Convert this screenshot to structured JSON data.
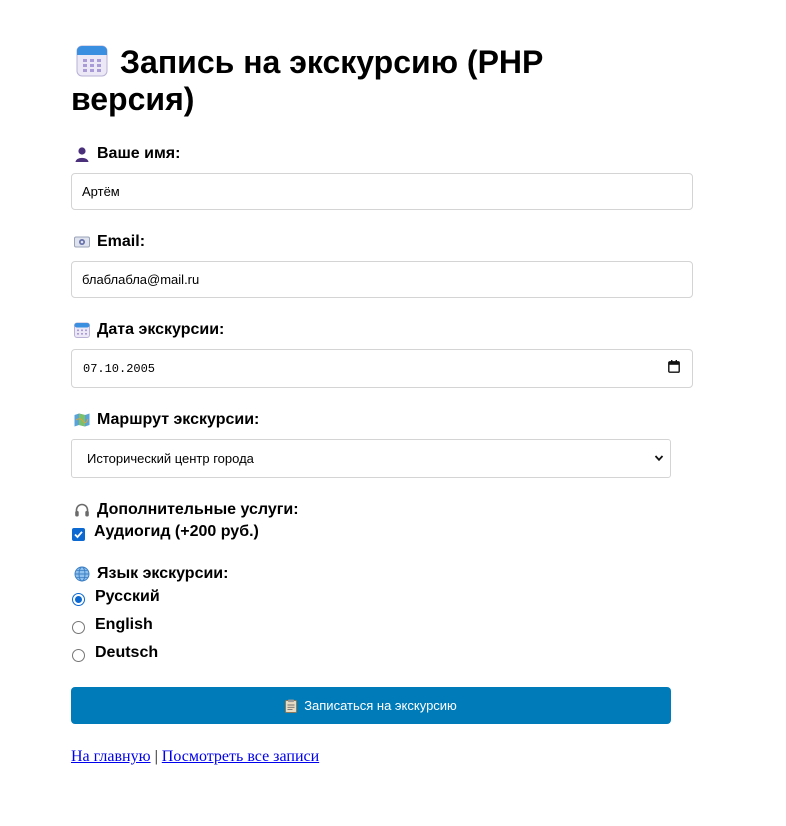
{
  "title": "Запись на экскурсию (PHP версия)",
  "form": {
    "name": {
      "label": "Ваше имя:",
      "value": "Артём"
    },
    "email": {
      "label": "Email:",
      "value": "блаблабла@mail.ru"
    },
    "date": {
      "label": "Дата экскурсии:",
      "value": "07.10.2005"
    },
    "route": {
      "label": "Маршрут экскурсии:",
      "selected": "Исторический центр города"
    },
    "extras": {
      "label": "Дополнительные услуги:",
      "audioguide": "Аудиогид (+200 руб.)",
      "audioguide_checked": true
    },
    "language": {
      "label": "Язык экскурсии:",
      "options": [
        "Русский",
        "English",
        "Deutsch"
      ],
      "selected": "Русский"
    },
    "submit_label": "Записаться на экскурсию"
  },
  "links": {
    "home": "На главную",
    "separator": "|",
    "all_records": "Посмотреть все записи"
  },
  "colors": {
    "button": "#007bba",
    "link": "#0000ee",
    "accent": "#0b69d1"
  }
}
